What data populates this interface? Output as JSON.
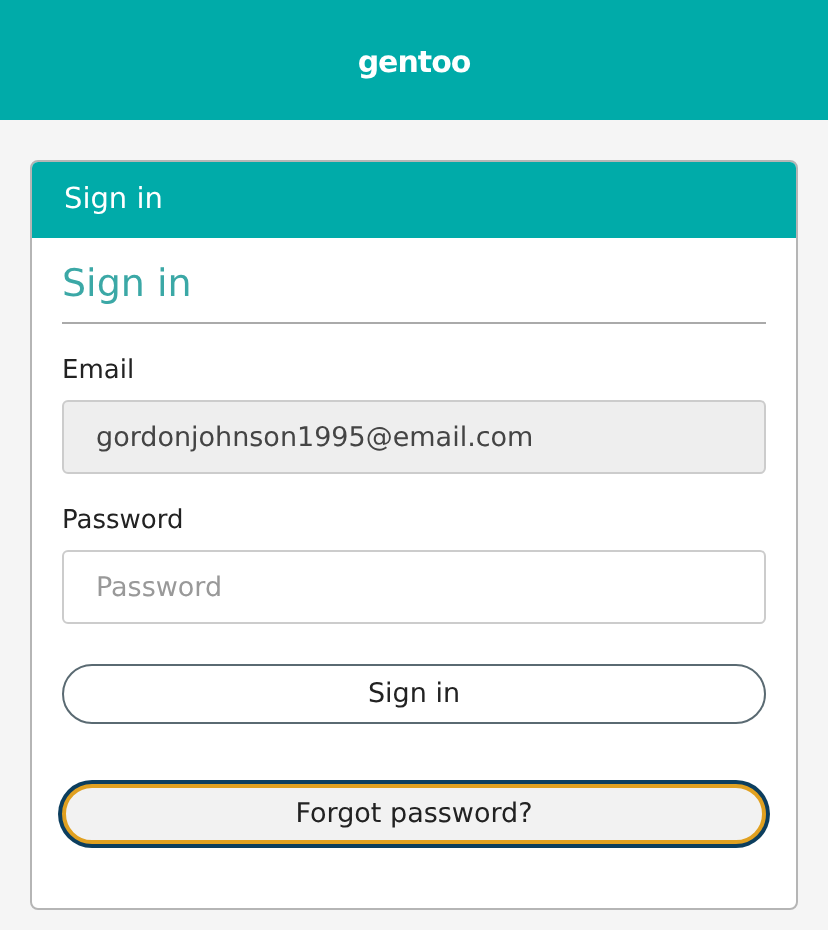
{
  "header": {
    "logo": "gentoo"
  },
  "card": {
    "title": "Sign in",
    "heading": "Sign in",
    "fields": [
      {
        "label": "Email",
        "value": "gordonjohnson1995@email.com",
        "disabled": true
      },
      {
        "label": "Password",
        "placeholder": "Password",
        "disabled": false
      }
    ],
    "buttons": [
      {
        "label": "Sign in",
        "focused": false
      },
      {
        "label": "Forgot password?",
        "focused": true
      }
    ]
  }
}
